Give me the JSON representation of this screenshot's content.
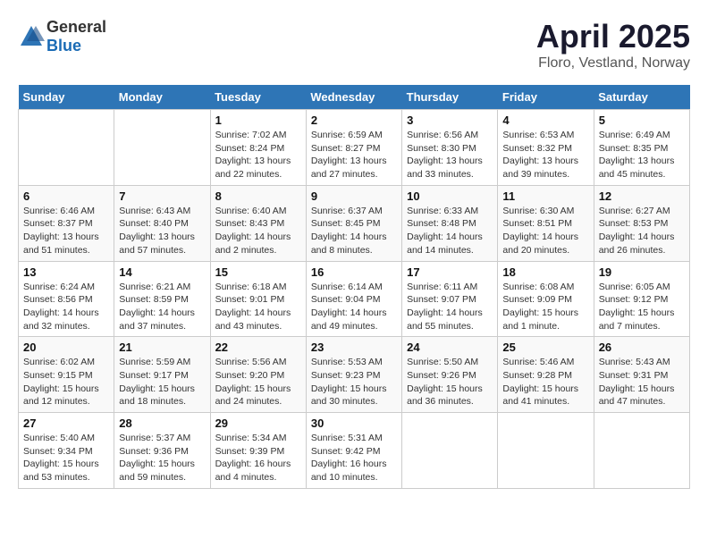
{
  "header": {
    "logo_general": "General",
    "logo_blue": "Blue",
    "month": "April 2025",
    "location": "Floro, Vestland, Norway"
  },
  "weekdays": [
    "Sunday",
    "Monday",
    "Tuesday",
    "Wednesday",
    "Thursday",
    "Friday",
    "Saturday"
  ],
  "weeks": [
    [
      {
        "day": "",
        "sunrise": "",
        "sunset": "",
        "daylight": ""
      },
      {
        "day": "",
        "sunrise": "",
        "sunset": "",
        "daylight": ""
      },
      {
        "day": "1",
        "sunrise": "Sunrise: 7:02 AM",
        "sunset": "Sunset: 8:24 PM",
        "daylight": "Daylight: 13 hours and 22 minutes."
      },
      {
        "day": "2",
        "sunrise": "Sunrise: 6:59 AM",
        "sunset": "Sunset: 8:27 PM",
        "daylight": "Daylight: 13 hours and 27 minutes."
      },
      {
        "day": "3",
        "sunrise": "Sunrise: 6:56 AM",
        "sunset": "Sunset: 8:30 PM",
        "daylight": "Daylight: 13 hours and 33 minutes."
      },
      {
        "day": "4",
        "sunrise": "Sunrise: 6:53 AM",
        "sunset": "Sunset: 8:32 PM",
        "daylight": "Daylight: 13 hours and 39 minutes."
      },
      {
        "day": "5",
        "sunrise": "Sunrise: 6:49 AM",
        "sunset": "Sunset: 8:35 PM",
        "daylight": "Daylight: 13 hours and 45 minutes."
      }
    ],
    [
      {
        "day": "6",
        "sunrise": "Sunrise: 6:46 AM",
        "sunset": "Sunset: 8:37 PM",
        "daylight": "Daylight: 13 hours and 51 minutes."
      },
      {
        "day": "7",
        "sunrise": "Sunrise: 6:43 AM",
        "sunset": "Sunset: 8:40 PM",
        "daylight": "Daylight: 13 hours and 57 minutes."
      },
      {
        "day": "8",
        "sunrise": "Sunrise: 6:40 AM",
        "sunset": "Sunset: 8:43 PM",
        "daylight": "Daylight: 14 hours and 2 minutes."
      },
      {
        "day": "9",
        "sunrise": "Sunrise: 6:37 AM",
        "sunset": "Sunset: 8:45 PM",
        "daylight": "Daylight: 14 hours and 8 minutes."
      },
      {
        "day": "10",
        "sunrise": "Sunrise: 6:33 AM",
        "sunset": "Sunset: 8:48 PM",
        "daylight": "Daylight: 14 hours and 14 minutes."
      },
      {
        "day": "11",
        "sunrise": "Sunrise: 6:30 AM",
        "sunset": "Sunset: 8:51 PM",
        "daylight": "Daylight: 14 hours and 20 minutes."
      },
      {
        "day": "12",
        "sunrise": "Sunrise: 6:27 AM",
        "sunset": "Sunset: 8:53 PM",
        "daylight": "Daylight: 14 hours and 26 minutes."
      }
    ],
    [
      {
        "day": "13",
        "sunrise": "Sunrise: 6:24 AM",
        "sunset": "Sunset: 8:56 PM",
        "daylight": "Daylight: 14 hours and 32 minutes."
      },
      {
        "day": "14",
        "sunrise": "Sunrise: 6:21 AM",
        "sunset": "Sunset: 8:59 PM",
        "daylight": "Daylight: 14 hours and 37 minutes."
      },
      {
        "day": "15",
        "sunrise": "Sunrise: 6:18 AM",
        "sunset": "Sunset: 9:01 PM",
        "daylight": "Daylight: 14 hours and 43 minutes."
      },
      {
        "day": "16",
        "sunrise": "Sunrise: 6:14 AM",
        "sunset": "Sunset: 9:04 PM",
        "daylight": "Daylight: 14 hours and 49 minutes."
      },
      {
        "day": "17",
        "sunrise": "Sunrise: 6:11 AM",
        "sunset": "Sunset: 9:07 PM",
        "daylight": "Daylight: 14 hours and 55 minutes."
      },
      {
        "day": "18",
        "sunrise": "Sunrise: 6:08 AM",
        "sunset": "Sunset: 9:09 PM",
        "daylight": "Daylight: 15 hours and 1 minute."
      },
      {
        "day": "19",
        "sunrise": "Sunrise: 6:05 AM",
        "sunset": "Sunset: 9:12 PM",
        "daylight": "Daylight: 15 hours and 7 minutes."
      }
    ],
    [
      {
        "day": "20",
        "sunrise": "Sunrise: 6:02 AM",
        "sunset": "Sunset: 9:15 PM",
        "daylight": "Daylight: 15 hours and 12 minutes."
      },
      {
        "day": "21",
        "sunrise": "Sunrise: 5:59 AM",
        "sunset": "Sunset: 9:17 PM",
        "daylight": "Daylight: 15 hours and 18 minutes."
      },
      {
        "day": "22",
        "sunrise": "Sunrise: 5:56 AM",
        "sunset": "Sunset: 9:20 PM",
        "daylight": "Daylight: 15 hours and 24 minutes."
      },
      {
        "day": "23",
        "sunrise": "Sunrise: 5:53 AM",
        "sunset": "Sunset: 9:23 PM",
        "daylight": "Daylight: 15 hours and 30 minutes."
      },
      {
        "day": "24",
        "sunrise": "Sunrise: 5:50 AM",
        "sunset": "Sunset: 9:26 PM",
        "daylight": "Daylight: 15 hours and 36 minutes."
      },
      {
        "day": "25",
        "sunrise": "Sunrise: 5:46 AM",
        "sunset": "Sunset: 9:28 PM",
        "daylight": "Daylight: 15 hours and 41 minutes."
      },
      {
        "day": "26",
        "sunrise": "Sunrise: 5:43 AM",
        "sunset": "Sunset: 9:31 PM",
        "daylight": "Daylight: 15 hours and 47 minutes."
      }
    ],
    [
      {
        "day": "27",
        "sunrise": "Sunrise: 5:40 AM",
        "sunset": "Sunset: 9:34 PM",
        "daylight": "Daylight: 15 hours and 53 minutes."
      },
      {
        "day": "28",
        "sunrise": "Sunrise: 5:37 AM",
        "sunset": "Sunset: 9:36 PM",
        "daylight": "Daylight: 15 hours and 59 minutes."
      },
      {
        "day": "29",
        "sunrise": "Sunrise: 5:34 AM",
        "sunset": "Sunset: 9:39 PM",
        "daylight": "Daylight: 16 hours and 4 minutes."
      },
      {
        "day": "30",
        "sunrise": "Sunrise: 5:31 AM",
        "sunset": "Sunset: 9:42 PM",
        "daylight": "Daylight: 16 hours and 10 minutes."
      },
      {
        "day": "",
        "sunrise": "",
        "sunset": "",
        "daylight": ""
      },
      {
        "day": "",
        "sunrise": "",
        "sunset": "",
        "daylight": ""
      },
      {
        "day": "",
        "sunrise": "",
        "sunset": "",
        "daylight": ""
      }
    ]
  ]
}
